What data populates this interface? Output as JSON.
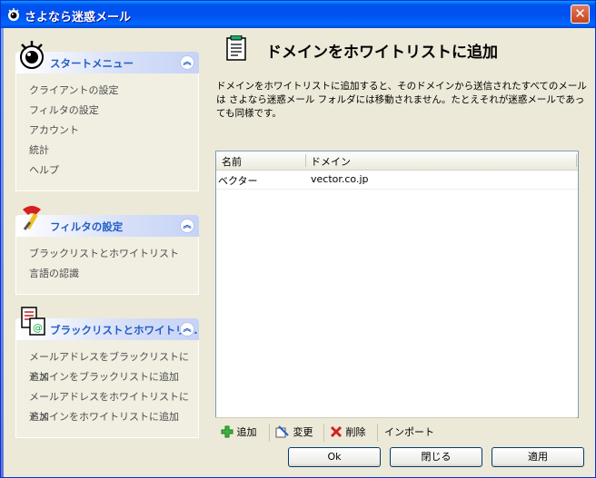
{
  "window": {
    "title": "さよなら迷惑メール"
  },
  "sidebar": {
    "panels": [
      {
        "title": "スタートメニュー",
        "items": [
          "クライアントの設定",
          "フィルタの設定",
          "アカウント",
          "統計",
          "ヘルプ"
        ]
      },
      {
        "title": "フィルタの設定",
        "items": [
          "ブラックリストとホワイトリスト",
          "言語の認識"
        ]
      },
      {
        "title": "ブラックリストとホワイトリ...",
        "items": [
          "メールアドレスをブラックリストに追加",
          "ドメインをブラックリストに追加",
          "メールアドレスをホワイトリストに追加",
          "ドメインをホワイトリストに追加"
        ]
      }
    ]
  },
  "main": {
    "heading": "ドメインをホワイトリストに追加",
    "description": "ドメインをホワイトリストに追加すると、そのドメインから送信されたすべてのメールは さよなら迷惑メール フォルダには移動されません。たとえそれが迷惑メールであっても同様です。",
    "list": {
      "columns": [
        "名前",
        "ドメイン"
      ],
      "rows": [
        {
          "name": "ベクター",
          "domain": "vector.co.jp"
        }
      ]
    },
    "toolbar": {
      "add": "追加",
      "edit": "変更",
      "delete": "削除",
      "import": "インポート"
    },
    "buttons": {
      "ok": "Ok",
      "close": "閉じる",
      "apply": "適用"
    }
  },
  "colors": {
    "title_bar": "#0053EE",
    "panel_title": "#215DC6",
    "window_bg": "#ECE9D8"
  }
}
